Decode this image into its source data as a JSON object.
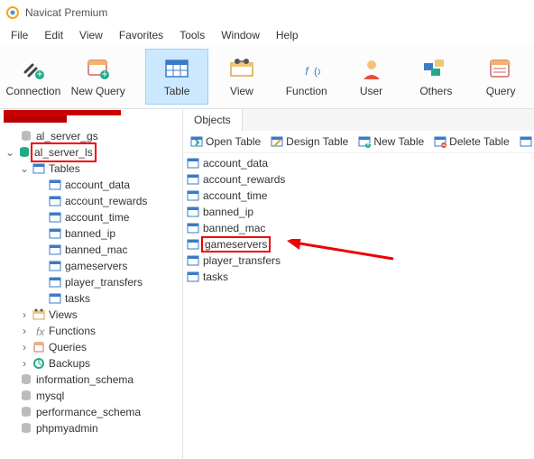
{
  "window": {
    "title": "Navicat Premium"
  },
  "menu": [
    "File",
    "Edit",
    "View",
    "Favorites",
    "Tools",
    "Window",
    "Help"
  ],
  "toolbar": [
    {
      "key": "connection",
      "label": "Connection"
    },
    {
      "key": "newquery",
      "label": "New Query"
    },
    {
      "key": "table",
      "label": "Table",
      "active": true
    },
    {
      "key": "view",
      "label": "View"
    },
    {
      "key": "function",
      "label": "Function"
    },
    {
      "key": "user",
      "label": "User"
    },
    {
      "key": "others",
      "label": "Others"
    },
    {
      "key": "query",
      "label": "Query"
    }
  ],
  "tree": {
    "dbs": [
      {
        "name": "al_server_gs",
        "open": false
      },
      {
        "name": "al_server_ls",
        "open": true,
        "highlight": true,
        "folders": {
          "tables": {
            "label": "Tables",
            "open": true,
            "items": [
              "account_data",
              "account_rewards",
              "account_time",
              "banned_ip",
              "banned_mac",
              "gameservers",
              "player_transfers",
              "tasks"
            ]
          },
          "views": {
            "label": "Views"
          },
          "functions": {
            "label": "Functions"
          },
          "queries": {
            "label": "Queries"
          },
          "backups": {
            "label": "Backups"
          }
        }
      },
      {
        "name": "information_schema",
        "open": false
      },
      {
        "name": "mysql",
        "open": false
      },
      {
        "name": "performance_schema",
        "open": false
      },
      {
        "name": "phpmyadmin",
        "open": false
      }
    ]
  },
  "objects": {
    "tab": "Objects",
    "toolbar": {
      "open": "Open Table",
      "design": "Design Table",
      "new": "New Table",
      "delete": "Delete Table"
    },
    "list": [
      "account_data",
      "account_rewards",
      "account_time",
      "banned_ip",
      "banned_mac",
      "gameservers",
      "player_transfers",
      "tasks"
    ],
    "highlight": "gameservers"
  }
}
